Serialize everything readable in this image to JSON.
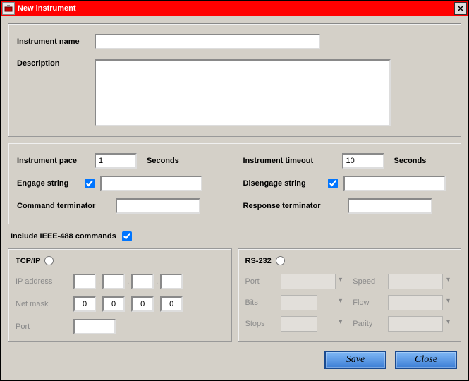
{
  "titlebar": {
    "text": "New instrument"
  },
  "section1": {
    "name_label": "Instrument name",
    "name_value": "",
    "desc_label": "Description",
    "desc_value": ""
  },
  "section2": {
    "pace_label": "Instrument pace",
    "pace_value": "1",
    "seconds_label": "Seconds",
    "timeout_label": "Instrument timeout",
    "timeout_value": "10",
    "engage_label": "Engage string",
    "engage_checked": true,
    "engage_value": "",
    "disengage_label": "Disengage string",
    "disengage_checked": true,
    "disengage_value": "",
    "cmdterm_label": "Command terminator",
    "cmdterm_value": "",
    "respterm_label": "Response terminator",
    "respterm_value": ""
  },
  "ieee": {
    "label": "Include IEEE-488 commands",
    "checked": true
  },
  "tcpip": {
    "title": "TCP/IP",
    "selected": false,
    "ip_label": "IP address",
    "ip": [
      "",
      "",
      "",
      ""
    ],
    "mask_label": "Net mask",
    "mask": [
      "0",
      "0",
      "0",
      "0"
    ],
    "port_label": "Port",
    "port_value": ""
  },
  "rs232": {
    "title": "RS-232",
    "selected": false,
    "port_label": "Port",
    "speed_label": "Speed",
    "bits_label": "Bits",
    "flow_label": "Flow",
    "stops_label": "Stops",
    "parity_label": "Parity"
  },
  "buttons": {
    "save": "Save",
    "close": "Close"
  }
}
